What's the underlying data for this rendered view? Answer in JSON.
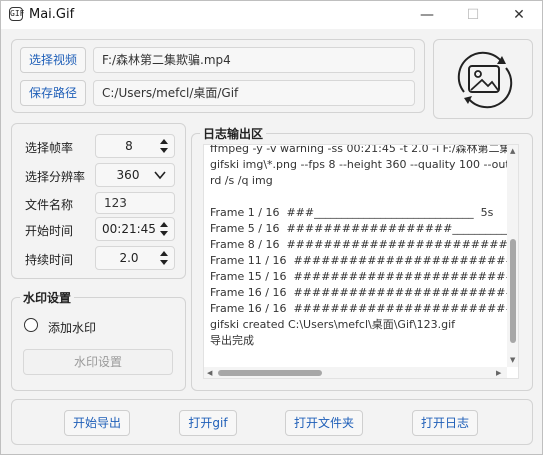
{
  "window": {
    "title": "Mai.Gif",
    "icon_text": "GIF",
    "controls": {
      "minimize": "—",
      "maximize": "☐",
      "close": "✕"
    }
  },
  "paths": {
    "select_video_label": "选择视频",
    "video_path": "F:/森林第二集欺骗.mp4",
    "save_path_label": "保存路径",
    "save_path": "C:/Users/mefcl/桌面/Gif"
  },
  "settings": {
    "fps_label": "选择帧率",
    "fps_value": "8",
    "resolution_label": "选择分辨率",
    "resolution_value": "360",
    "filename_label": "文件名称",
    "filename_value": "123",
    "start_label": "开始时间",
    "start_value": "00:21:45",
    "duration_label": "持续时间",
    "duration_value": "2.0"
  },
  "watermark": {
    "section_title": "水印设置",
    "add_label": "添加水印",
    "settings_button": "水印设置"
  },
  "log": {
    "section_title": "日志输出区",
    "text": "ffmpeg -y -v warning -ss 00:21:45 -t 2.0 -i F:/森林第二集欺\ngifski img\\*.png --fps 8 --height 360 --quality 100 --outp\nrd /s /q img\n\nFrame 1 / 16  ###_____________________________  5s\nFrame 5 / 16  ##################__________________\nFrame 8 / 16  ############################__\nFrame 11 / 16  ##############################\nFrame 15 / 16  ##############################\nFrame 16 / 16  ##############################\nFrame 16 / 16  ##############################\ngifski created C:\\Users\\mefcl\\桌面\\Gif\\123.gif\n导出完成"
  },
  "actions": {
    "start_export": "开始导出",
    "open_gif": "打开gif",
    "open_folder": "打开文件夹",
    "open_log": "打开日志"
  },
  "colors": {
    "accent_text": "#1f5fb8",
    "background": "#f3f3f3",
    "border": "#d3d3d3"
  }
}
